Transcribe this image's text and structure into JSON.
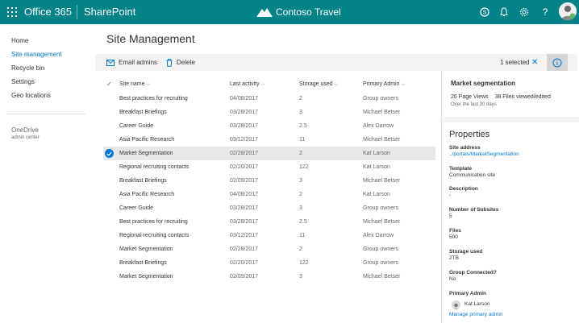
{
  "topbar": {
    "app_name": "Office 365",
    "suite_name": "SharePoint",
    "site_name": "Contoso Travel",
    "icons": [
      "waffle-icon",
      "skype-icon",
      "bell-icon",
      "gear-icon",
      "help-icon"
    ],
    "help_glyph": "?",
    "color": "#038387"
  },
  "nav": {
    "items": [
      "Home",
      "Site management",
      "Recycle bin",
      "Settings",
      "Geo locations"
    ],
    "active_index": 1,
    "onedrive_label": "OneDrive",
    "onedrive_sub": "admin center"
  },
  "page": {
    "title": "Site Management"
  },
  "commands": {
    "email_admins": "Email admins",
    "delete": "Delete",
    "selected": "1 selected",
    "clear": "✕"
  },
  "table": {
    "columns": [
      "Site name",
      "Last activity",
      "Storage used",
      "Primary Admin"
    ],
    "rows": [
      [
        "Best practices for recruiting",
        "04/08/2017",
        "2",
        "Group owners"
      ],
      [
        "Breakfast Briefings",
        "03/28/2017",
        "3",
        "Michael Betser"
      ],
      [
        "Career Guide",
        "03/28/2017",
        "2.5",
        "Alex Darrow"
      ],
      [
        "Asia Pacific Research",
        "03/12/2017",
        "11",
        "Michael Betser"
      ],
      [
        "Market Segmentation",
        "02/28/2017",
        "2",
        "Kat Larson"
      ],
      [
        "Regional recruiting contacts",
        "02/20/2017",
        "122",
        "Kat Larson"
      ],
      [
        "Breakfast Briefings",
        "02/09/2017",
        "3",
        "Michael Betser"
      ],
      [
        "Asia Pacific Research",
        "04/08/2017",
        "2",
        "Kat Larson"
      ],
      [
        "Career Guide",
        "03/28/2017",
        "3",
        "Group owners"
      ],
      [
        "Best practices for recruiting",
        "03/28/2017",
        "2.5",
        "Michael Betser"
      ],
      [
        "Regional recruiting contacts",
        "03/12/2017",
        "11",
        "Alex Darrow"
      ],
      [
        "Market Segmentation",
        "02/28/2017",
        "2",
        "Group owners"
      ],
      [
        "Breakfast Briefings",
        "02/20/2017",
        "122",
        "Group owners"
      ],
      [
        "Market Segmentation",
        "02/09/2017",
        "3",
        "Michael Betser"
      ]
    ],
    "selected_index": 4
  },
  "details": {
    "title": "Market segmentation",
    "page_views": "26 Page Views",
    "files_viewed": "38 Files viewed/edited",
    "period": "Over the last 30 days",
    "properties_title": "Properties",
    "site_address_label": "Site address",
    "site_address_value": "../portals/MarketSegmentation",
    "template_label": "Template",
    "template_value": "Communication site",
    "description_label": "Description",
    "description_value": "-",
    "subsites_label": "Number of Subsites",
    "subsites_value": "5",
    "files_label": "Files",
    "files_value": "500",
    "storage_label": "Storage used",
    "storage_value": "2TB",
    "group_label": "Group Connected?",
    "group_value": "No",
    "admin_label": "Primary Admin",
    "admin_name": "Kat Larson",
    "manage_link": "Manage primary admin"
  }
}
